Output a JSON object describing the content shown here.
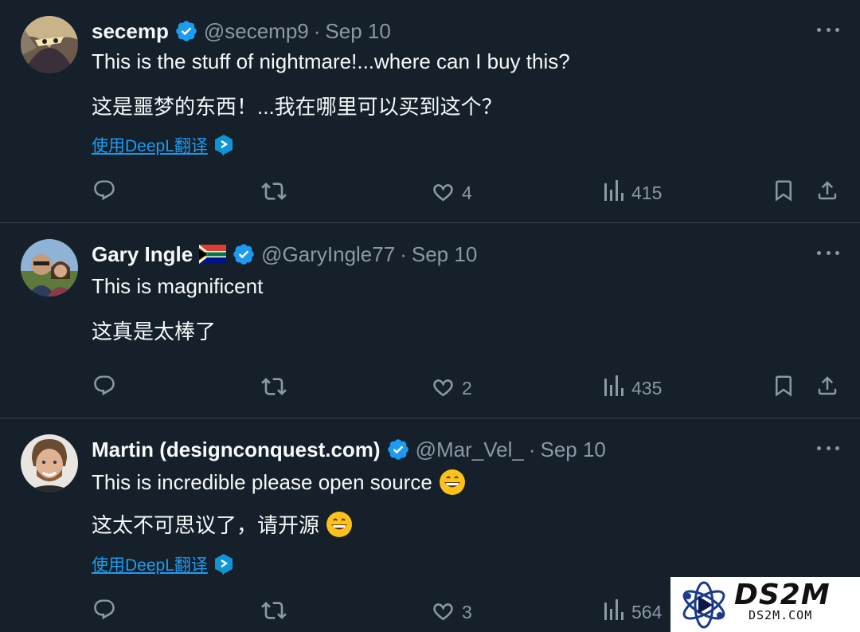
{
  "tweets": [
    {
      "name": "secemp",
      "handle": "@secemp9",
      "separator": "·",
      "time": "Sep 10",
      "text": "This is the stuff of nightmare!...where can I buy this?",
      "translation": "这是噩梦的东西！...我在哪里可以买到这个？",
      "translate_link": "使用DeepL翻译",
      "likes": "4",
      "views": "415"
    },
    {
      "name": "Gary Ingle",
      "flag_icon": "south-africa-flag-icon",
      "handle": "@GaryIngle77",
      "separator": "·",
      "time": "Sep 10",
      "text": "This is magnificent",
      "translation": "这真是太棒了",
      "likes": "2",
      "views": "435"
    },
    {
      "name": "Martin (designconquest.com)",
      "handle": "@Mar_Vel_",
      "separator": "·",
      "time": "Sep 10",
      "text": "This is incredible please open source",
      "translation": "这太不可思议了，请开源",
      "translate_link": "使用DeepL翻译",
      "likes": "3",
      "views": "564"
    }
  ],
  "watermark": {
    "title": "DS2M",
    "subtitle": "DS2M.COM"
  },
  "colors": {
    "background": "#15202b",
    "text": "#f7f9f9",
    "muted": "#8b98a5",
    "link": "#1d9bf0",
    "verified": "#1d9bf0",
    "divider": "#38444d"
  }
}
